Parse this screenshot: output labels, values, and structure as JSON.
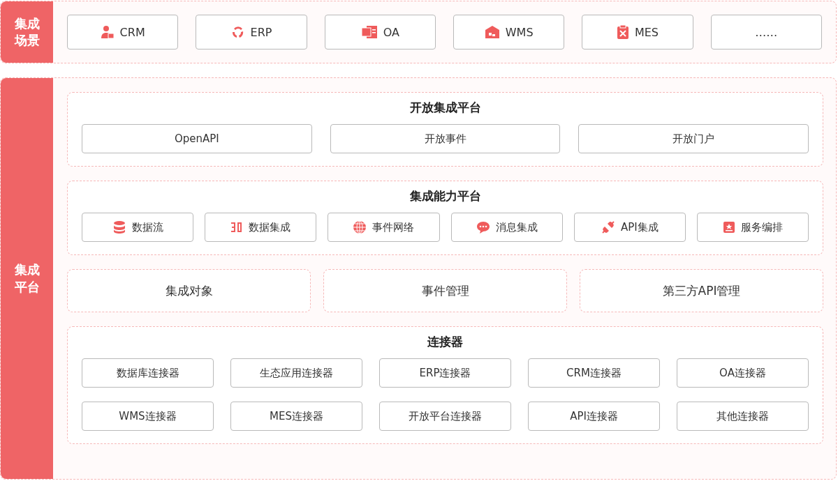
{
  "scenarios": {
    "label": "集成场景",
    "items": [
      "CRM",
      "ERP",
      "OA",
      "WMS",
      "MES",
      "……"
    ]
  },
  "platform": {
    "label": "集成平台",
    "open_platform": {
      "title": "开放集成平台",
      "items": [
        "OpenAPI",
        "开放事件",
        "开放门户"
      ]
    },
    "capability_platform": {
      "title": "集成能力平台",
      "items": [
        "数据流",
        "数据集成",
        "事件网络",
        "消息集成",
        "API集成",
        "服务编排"
      ]
    },
    "modules": [
      "集成对象",
      "事件管理",
      "第三方API管理"
    ],
    "connectors": {
      "title": "连接器",
      "items": [
        "数据库连接器",
        "生态应用连接器",
        "ERP连接器",
        "CRM连接器",
        "OA连接器",
        "WMS连接器",
        "MES连接器",
        "开放平台连接器",
        "API连接器",
        "其他连接器"
      ]
    }
  }
}
